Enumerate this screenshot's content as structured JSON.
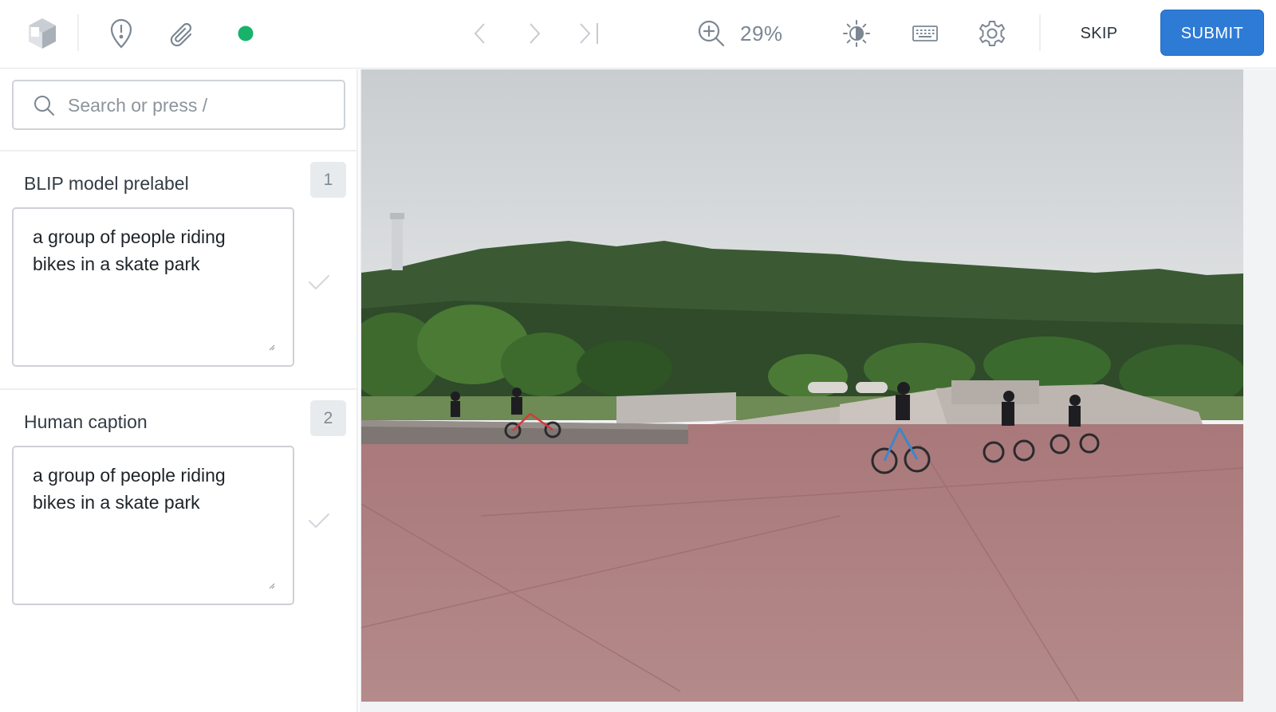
{
  "toolbar": {
    "zoom_value": "29%",
    "skip_label": "SKIP",
    "submit_label": "SUBMIT",
    "status_color": "#19b26b",
    "accent_color": "#2e7bd6"
  },
  "search": {
    "placeholder": "Search or press /"
  },
  "sections": [
    {
      "title": "BLIP model prelabel",
      "badge": "1",
      "text": "a group of people riding bikes in a skate park"
    },
    {
      "title": "Human caption",
      "badge": "2",
      "text": "a group of people riding bikes in a skate park"
    }
  ],
  "icons": {
    "toolbar": [
      "logo-icon",
      "alert-icon",
      "paperclip-icon",
      "status-dot-icon",
      "chevron-left-icon",
      "chevron-right-icon",
      "skip-last-icon",
      "zoom-in-icon",
      "brightness-icon",
      "keyboard-icon",
      "gear-icon"
    ],
    "sidebar": [
      "search-icon",
      "check-icon",
      "resize-grip-icon"
    ]
  }
}
